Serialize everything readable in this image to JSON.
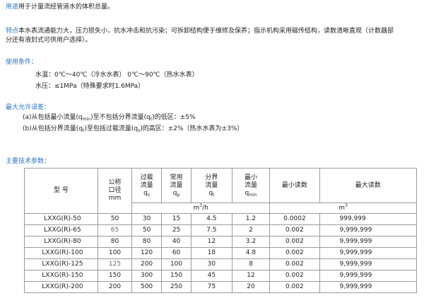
{
  "usage": {
    "label": "用途",
    "text": "用于计量流经管道水的体积总量。"
  },
  "features": {
    "label": "特点",
    "line1": "本水表流通能力大，压力损失小，抗水冲击和抗污染；可拆卸结构便于维修及保养；指示机构采用磁传结构，读数清晰直观（计数器部",
    "line2": "分还有液封式可供用户选择）。"
  },
  "conditions": {
    "title": "使用条件：",
    "temp_label": "水温：",
    "temp_value": "0℃～40℃（冷水水表）  0℃～90℃（热水水表）",
    "pressure_label": "水压：",
    "pressure_value": "≤1MPa（特殊要求时1.6MPa）"
  },
  "errors": {
    "title": "最大允许误差：",
    "a_prefix": "(a)从包括最小流量(q",
    "a_sub": "min",
    "a_mid": ")至不包括分界流量(q",
    "a_sub2": "t",
    "a_suffix": ")的低区：±5%",
    "b_prefix": "(b)从包括分界流量(q",
    "b_sub": "t",
    "b_mid": ")至包括过载流量(q",
    "b_sub2": "s",
    "b_suffix": ")的高区：±2%（热水水表为±3%）"
  },
  "specs": {
    "title": "主要技术参数：",
    "headers": {
      "model": "型  号",
      "dn_1": "公称",
      "dn_2": "口径",
      "dn_3": "mm",
      "qs_1": "过载",
      "qs_2": "流量",
      "qs_3": "q",
      "qs_sub": "s",
      "qp_1": "常用",
      "qp_2": "流量",
      "qp_3": "q",
      "qp_sub": "p",
      "qt_1": "分界",
      "qt_2": "流量",
      "qt_3": "q",
      "qt_sub": "t",
      "qmin_1": "最小",
      "qmin_2": "流量",
      "qmin_3": "q",
      "qmin_sub": "min",
      "min_read": "最小读数",
      "max_read": "最大读数",
      "unit_flow": "m",
      "unit_flow_sup": "3",
      "unit_flow_tail": "/h",
      "unit_vol": "m",
      "unit_vol_sup": "3"
    },
    "rows": [
      {
        "model": "LXXG(R)-50",
        "dn": "50",
        "qs": "30",
        "qp": "15",
        "qt": "4.5",
        "qmin": "1.2",
        "min": "0.0002",
        "max": "999,999"
      },
      {
        "model": "LXXG(R)-65",
        "dn": "65",
        "qs": "50",
        "qp": "25",
        "qt": "7.5",
        "qmin": "2",
        "min": "0.002",
        "max": "9,999,999"
      },
      {
        "model": "LXXG(R)-80",
        "dn": "80",
        "qs": "80",
        "qp": "40",
        "qt": "12",
        "qmin": "3.2",
        "min": "0.002",
        "max": "9,999,999"
      },
      {
        "model": "LXXG(R)-100",
        "dn": "100",
        "qs": "120",
        "qp": "60",
        "qt": "18",
        "qmin": "4.8",
        "min": "0.002",
        "max": "9,999,999"
      },
      {
        "model": "LXXG(R)-125",
        "dn": "125",
        "qs": "200",
        "qp": "100",
        "qt": "30",
        "qmin": "8",
        "min": "0.002",
        "max": "9,999,999"
      },
      {
        "model": "LXXG(R)-150",
        "dn": "150",
        "qs": "300",
        "qp": "150",
        "qt": "45",
        "qmin": "12",
        "min": "0.002",
        "max": "9,999,999"
      },
      {
        "model": "LXXG(R)-200",
        "dn": "200",
        "qs": "500",
        "qp": "250",
        "qt": "75",
        "qmin": "20",
        "min": "0.002",
        "max": "9,999,999"
      }
    ]
  },
  "colors": {
    "accent": "#2b76c2",
    "text": "#222222",
    "border": "#9a9a9a"
  }
}
